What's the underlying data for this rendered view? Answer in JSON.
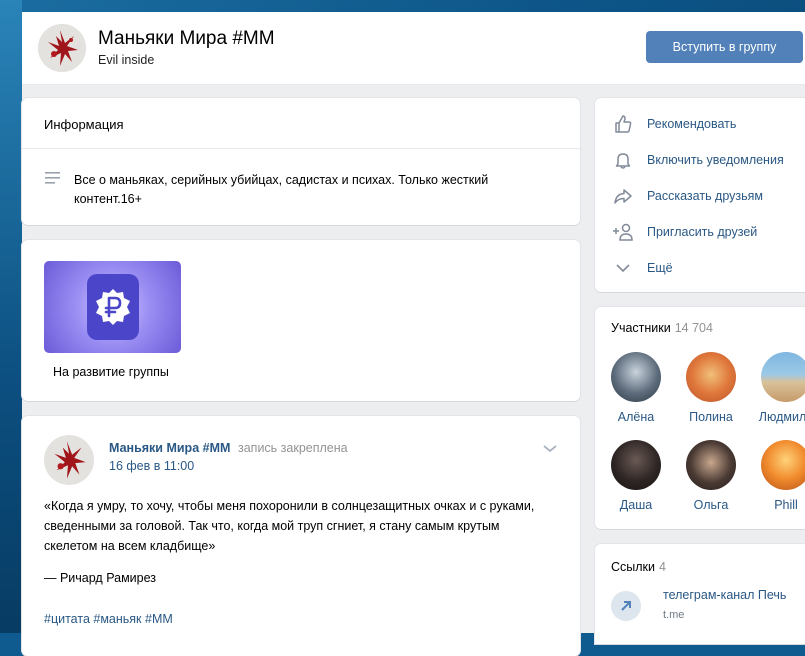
{
  "group": {
    "title": "Маньяки Мира #ММ",
    "status": "Evil inside",
    "join_label": "Вступить в группу"
  },
  "info": {
    "heading": "Информация",
    "description": "Все о маньяках, серийных убийцах, садистах и психах. Только жесткий контент.16+"
  },
  "donate": {
    "caption": "На развитие группы",
    "icon": "ruble-icon"
  },
  "post": {
    "author": "Маньяки Мира #ММ",
    "pinned_note": "запись закреплена",
    "date": "16 фев в 11:00",
    "text": "«Когда я умру, то хочу, чтобы меня похоронили в солнцезащитных очках и с руками, сведенными за головой. Так что, когда мой труп сгниет, я стану самым крутым скелетом на всем кладбище»",
    "signature": "— Ричард Рамирез",
    "tags": "#цитата #маньяк #ММ"
  },
  "actions": [
    {
      "label": "Рекомендовать",
      "icon": "thumbs-up-icon"
    },
    {
      "label": "Включить уведомления",
      "icon": "bell-icon"
    },
    {
      "label": "Рассказать друзьям",
      "icon": "share-icon"
    },
    {
      "label": "Пригласить друзей",
      "icon": "add-user-icon"
    },
    {
      "label": "Ещё",
      "icon": "chevron-down-icon"
    }
  ],
  "members": {
    "title": "Участники",
    "count": "14 704",
    "list": [
      {
        "name": "Алёна"
      },
      {
        "name": "Полина"
      },
      {
        "name": "Людмила"
      },
      {
        "name": "Даша"
      },
      {
        "name": "Ольга"
      },
      {
        "name": "Phill"
      }
    ]
  },
  "links": {
    "title": "Ссылки",
    "count": "4",
    "items": [
      {
        "name": "телеграм-канал Печь",
        "url": "t.me"
      }
    ]
  },
  "colors": {
    "accent": "#5181b8",
    "link": "#2a5885",
    "page_bg": "#edeef0"
  }
}
